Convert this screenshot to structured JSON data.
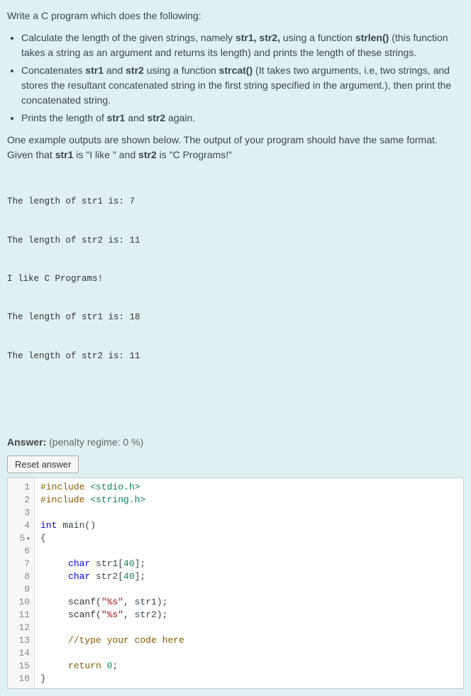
{
  "question": {
    "intro": "Write a C program which does the following:",
    "bullets": [
      {
        "prefix": "Calculate the length of the given strings, namely ",
        "b1": "str1, str2,",
        "mid1": " using a function ",
        "b2": "strlen()",
        "suffix": " (this function takes a string as an argument and returns its length) and prints the length of these strings."
      },
      {
        "prefix": "Concatenates ",
        "b1": "str1",
        "mid1": " and ",
        "b2": "str2",
        "mid2": " using a function ",
        "b3": "strcat()",
        "suffix": " (It takes two arguments, i.e, two strings, and stores the resultant concatenated string in the first string specified in the argument.), then print the concatenated string."
      },
      {
        "prefix": "Prints the length of ",
        "b1": "str1",
        "mid1": " and ",
        "b2": "str2",
        "suffix": " again."
      }
    ],
    "example_intro_prefix": "One example outputs are shown below. The output of your program should have the same format. Given that ",
    "b_str1": "str1",
    "mid_is1": " is \"I like \" and ",
    "b_str2": "str2",
    "mid_is2": " is \"C Programs!\"",
    "output_lines": [
      "The length of str1 is: 7",
      "The length of str2 is: 11",
      "I like C Programs!",
      "The length of str1 is: 18",
      "The length of str2 is: 11"
    ]
  },
  "answer": {
    "label": "Answer:",
    "penalty": "(penalty regime: 0 %)",
    "reset_label": "Reset answer"
  },
  "code": {
    "lines": {
      "l1": {
        "preproc": "#include",
        "inc": " <stdio.h>"
      },
      "l2": {
        "preproc": "#include",
        "inc": " <string.h>"
      },
      "l3": "",
      "l4": {
        "type": "int",
        "rest": " main()"
      },
      "l5": "{",
      "l6": "",
      "l7": {
        "indent": "     ",
        "type": "char",
        "rest": " str1[",
        "num": "40",
        "close": "];"
      },
      "l8": {
        "indent": "     ",
        "type": "char",
        "rest": " str2[",
        "num": "40",
        "close": "];"
      },
      "l9": "",
      "l10": {
        "indent": "     ",
        "fn": "scanf(",
        "str": "\"%s\"",
        "rest": ", str1);"
      },
      "l11": {
        "indent": "     ",
        "fn": "scanf(",
        "str": "\"%s\"",
        "rest": ", str2);"
      },
      "l12": "",
      "l13": {
        "indent": "     ",
        "comment": "//type your code here"
      },
      "l14": "",
      "l15": {
        "indent": "     ",
        "ret": "return",
        "sp": " ",
        "num": "0",
        "close": ";"
      },
      "l16": "}"
    },
    "line_numbers": [
      "1",
      "2",
      "3",
      "4",
      "5",
      "6",
      "7",
      "8",
      "9",
      "10",
      "11",
      "12",
      "13",
      "14",
      "15",
      "16"
    ]
  }
}
